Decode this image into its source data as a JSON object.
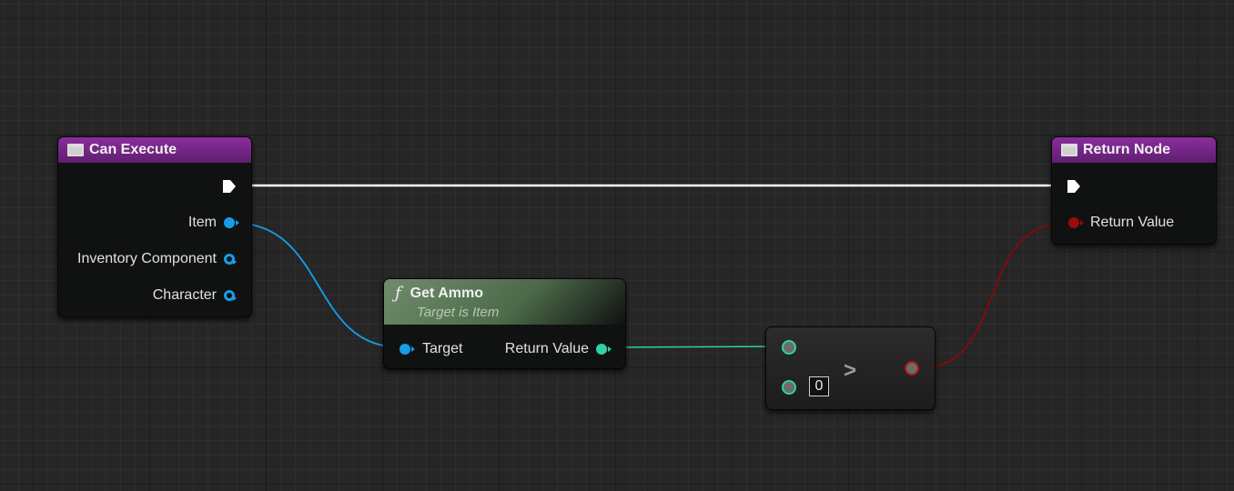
{
  "nodes": {
    "can_execute": {
      "title": "Can Execute",
      "outputs": [
        "Item",
        "Inventory Component",
        "Character"
      ]
    },
    "return_node": {
      "title": "Return Node",
      "input_label": "Return Value"
    },
    "get_ammo": {
      "title": "Get Ammo",
      "subtitle": "Target is Item",
      "input_label": "Target",
      "output_label": "Return Value",
      "icon_glyph": "ƒ"
    },
    "compare": {
      "operator": ">",
      "literal": "0"
    }
  },
  "colors": {
    "background": "#262626",
    "purple_header": "#5e1f70",
    "green_header": "#4d6b4a",
    "object_pin": "#169ee8",
    "int_pin": "#2ed2a7",
    "bool_pin": "#9a0b0b",
    "exec_wire": "#ffffff"
  }
}
